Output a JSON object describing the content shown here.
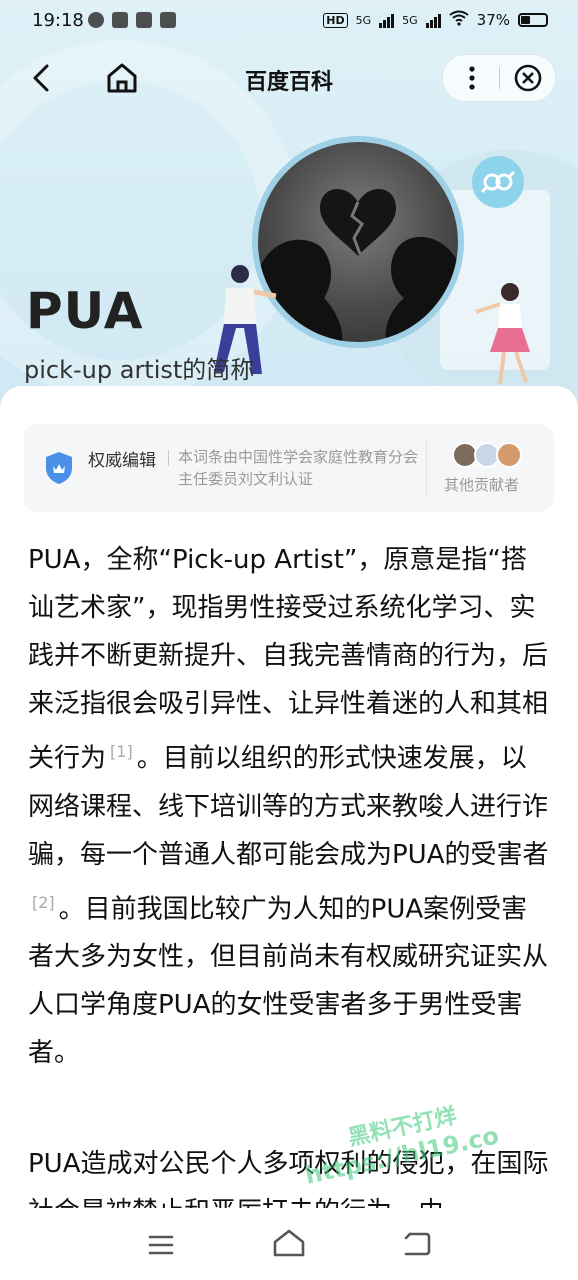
{
  "status_bar": {
    "time": "19:18",
    "network_badge": "HD",
    "net1": "5G",
    "net2": "5G",
    "battery": "37%"
  },
  "nav": {
    "title": "百度百科",
    "icons": [
      "back-icon",
      "home-icon",
      "more-icon",
      "close-icon"
    ]
  },
  "hero": {
    "title": "PUA",
    "subtitle": "pick-up artist的简称"
  },
  "editor": {
    "label": "权威编辑",
    "description": "本词条由中国性学会家庭性教育分会主任委员刘文利认证",
    "contributors_label": "其他贡献者"
  },
  "article": {
    "p1_a": "PUA，全称“Pick-up Artist”，原意是指“搭讪艺术家”，现指男性接受过系统化学习、实践并不断更新提升、自我完善情商的行为，后来泛指很会吸引异性、让异性着迷的人和其相关行为",
    "ref1": "[1]",
    "p1_b": "。目前以组织的形式快速发展，以网络课程、线下培训等的方式来教唆人进行诈骗，每一个普通人都可能会成为PUA的受害者",
    "ref2": "[2]",
    "p1_c": "。目前我国比较广为人知的PUA案例受害者大多为女性，但目前尚未有权威研究证实从人口学角度PUA的女性受害者多于男性受害者。",
    "p2": "PUA造成对公民个人多项权利的侵犯，在国际社会是被禁止和严厉打击的行为。由"
  },
  "watermark": {
    "line1": "黑料不打烊",
    "line2": "https://hl19.co"
  },
  "colors": {
    "hero_bg": "#d7edf5",
    "accent_blue": "#4a8fe8",
    "muted_text": "#9a9a9a"
  }
}
